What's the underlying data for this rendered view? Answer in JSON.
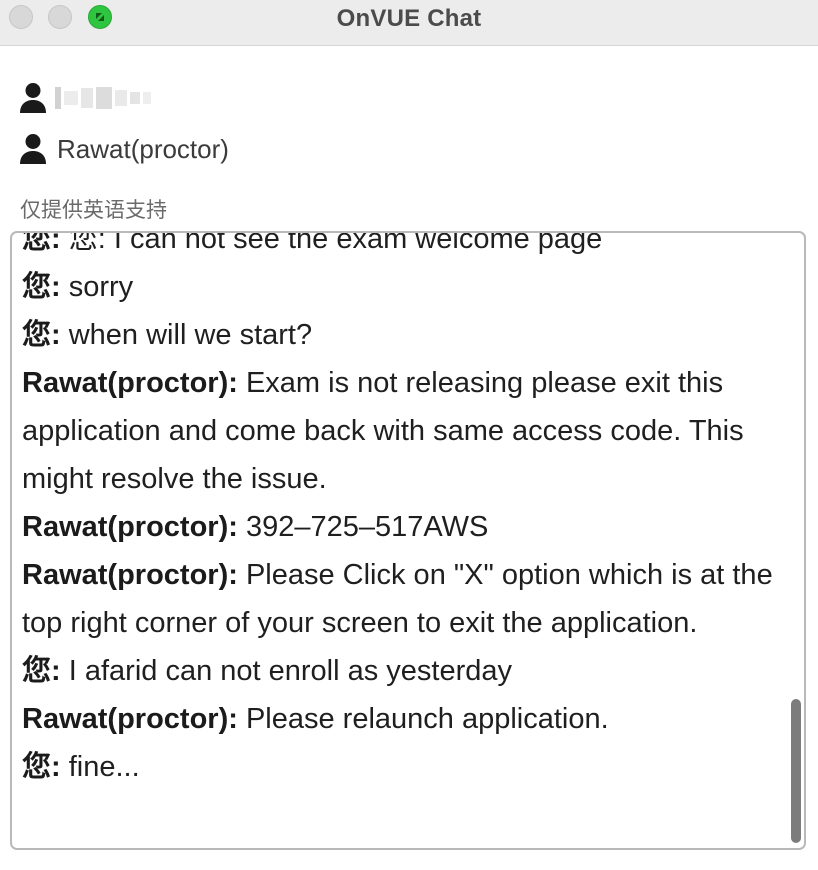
{
  "window": {
    "title": "OnVUE Chat",
    "controls": {
      "close_color": "#d8d8d8",
      "minimize_color": "#d8d8d8",
      "zoom_color": "#2fc541"
    }
  },
  "participants": [
    {
      "icon": "person-icon",
      "name": "",
      "redacted": true
    },
    {
      "icon": "person-icon",
      "name": "Rawat(proctor)",
      "redacted": false
    }
  ],
  "support_note": "仅提供英语支持",
  "messages": [
    {
      "sender": "您:",
      "text": " 您: I can not see the exam welcome page"
    },
    {
      "sender": "您:",
      "text": " sorry"
    },
    {
      "sender": "您:",
      "text": " when will we start?"
    },
    {
      "sender": "Rawat(proctor):",
      "text": " Exam is not releasing please exit this application and come back with same access code. This might resolve the issue."
    },
    {
      "sender": "Rawat(proctor):",
      "text": " 392–725–517AWS"
    },
    {
      "sender": "Rawat(proctor):",
      "text": " Please Click on \"X\" option which is at the top right corner of your screen to exit the application."
    },
    {
      "sender": "您:",
      "text": " I afarid can not enroll as yesterday"
    },
    {
      "sender": "Rawat(proctor):",
      "text": " Please relaunch application."
    },
    {
      "sender": "您:",
      "text": " fine..."
    }
  ]
}
